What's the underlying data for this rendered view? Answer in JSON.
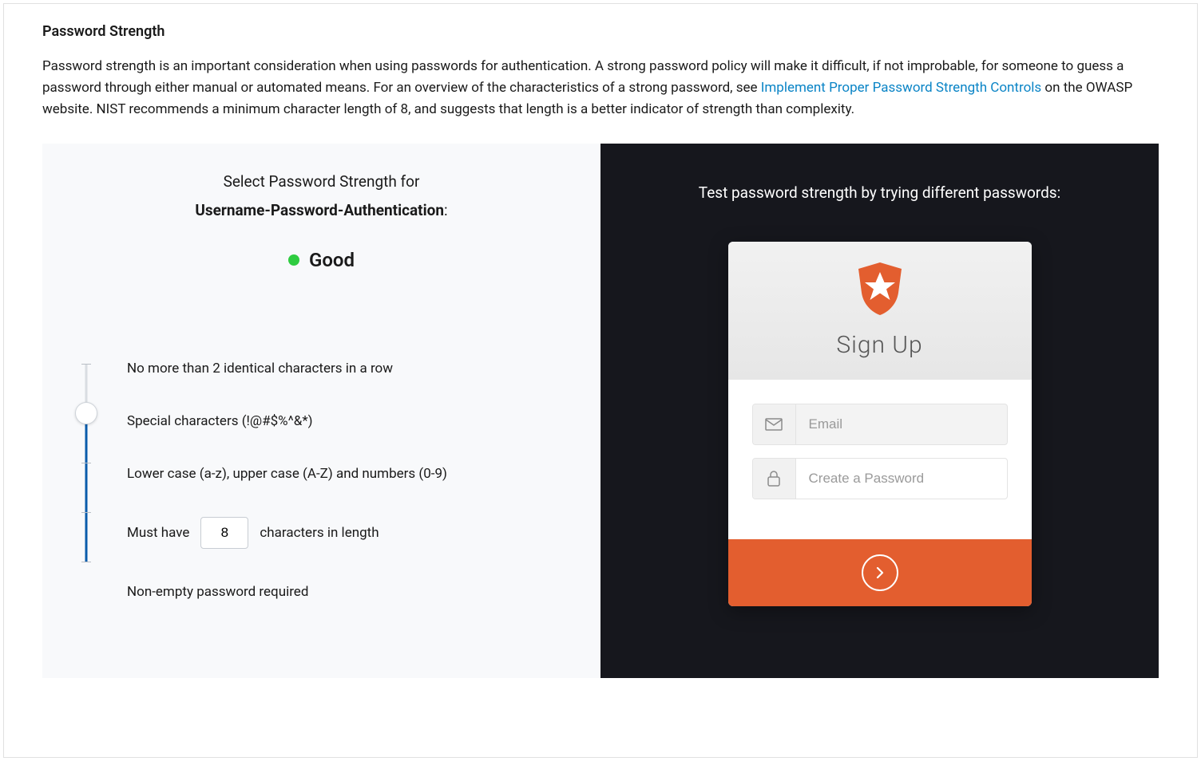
{
  "section": {
    "title": "Password Strength",
    "desc_part1": "Password strength is an important consideration when using passwords for authentication. A strong password policy will make it difficult, if not improbable, for someone to guess a password through either manual or automated means. For an overview of the characteristics of a strong password, see ",
    "link_text": "Implement Proper Password Strength Controls",
    "desc_part2": " on the OWASP website. NIST recommends a minimum character length of 8, and suggests that length is a better indicator of strength than complexity."
  },
  "left": {
    "header_line1": "Select Password Strength for",
    "connection_name": "Username-Password-Authentication",
    "colon": ":",
    "strength_label": "Good",
    "strength_color": "#2ecc40",
    "rules": {
      "r0": "No more than 2 identical characters in a row",
      "r1": "Special characters (!@#$%^&*)",
      "r2": "Lower case (a-z), upper case (A-Z) and numbers (0-9)",
      "r3_prefix": "Must have",
      "r3_value": "8",
      "r3_suffix": "characters in length",
      "r4": "Non-empty password required"
    },
    "slider": {
      "levels": 5,
      "selected_index": 1
    }
  },
  "right": {
    "prompt": "Test password strength by trying different passwords:",
    "signup_title": "Sign Up",
    "email_placeholder": "Email",
    "password_placeholder": "Create a Password",
    "brand_color": "#e35e2f"
  }
}
